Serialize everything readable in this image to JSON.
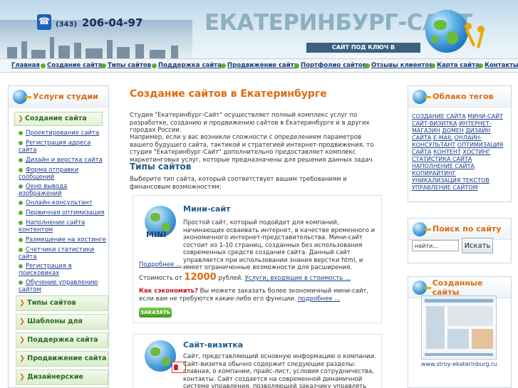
{
  "header": {
    "phone_code": "(343)",
    "phone_number": "206-04-97",
    "site_title": "ЕКАТЕРИНБУРГ-САЙТ",
    "slogan": "САЙТ ПОД КЛЮЧ В ЕКАТЕРИНБУРГЕ"
  },
  "topnav": [
    "Главная",
    "Создание сайта",
    "Типы сайтов",
    "Поддержка сайта",
    "Продвижение сайта",
    "Портфолио сайтов",
    "Отзывы клиентов",
    "Карта сайта",
    "Контакты"
  ],
  "left": {
    "title": "Услуги студии",
    "active_section": "Создание сайта",
    "sub_items": [
      "Проектирование сайта",
      "Регистрация адреса сайта",
      "Дизайн и верстка сайта",
      "Форма отправки сообщений",
      "Окно вывода изображений",
      "Онлайн-консультант",
      "Первичная оптимизация",
      "Наполнение сайта контентом",
      "Размещение на хостинге",
      "Счетчики статистики сайта",
      "Регистрация в поисковиках",
      "Обучение управлению сайтом"
    ],
    "sections": [
      "Типы сайтов",
      "Шаблоны для сайтов",
      "Поддержка сайта",
      "Продвижение сайта",
      "Дизайнерские услуги"
    ]
  },
  "main": {
    "title": "Создание сайтов в Екатеринбурге",
    "intro_1": "Студия \"Екатеринбург-Сайт\" осуществляет полный комплекс услуг по разработке, созданию и продвижению сайтов в Екатеринбурге и в других городах России.",
    "intro_2": "Например, если у вас возникли сложности с определением параметров вашего будущего сайта, тактикой и стратегией интернет-продвижения, то студия \"Екатеринбург-Сайт\" дополнительно предоставляет комплекс маркетинговых услуг, которые предназначены для решения данных задач.",
    "types_title": "Типы сайтов",
    "types_intro": "Выберите тип сайта, который соответствует вашим требованиям и финансовым возможностям:",
    "cards": [
      {
        "title": "Мини-сайт",
        "badge": "MINI",
        "text": "Простой сайт, который подойдет для компаний, начинающих осваивать интернет, в качестве временного и экономичного интернет-представительства. Мини-сайт состоит из 1-10 страниц, созданных без использования современных средств создания сайта. Данный сайт управляется при использовании знания верстки html, и имеет ограниченные возможности для расширения.",
        "more": "Подробнее ...",
        "price_label": "Стоимость от",
        "price": "12000",
        "price_unit": "рублей.",
        "services_link": "Услуги, входящие в стоимость ...",
        "save_label": "Как сэкономить?",
        "save_text": "Вы можете заказать более экономичный мини-сайт, если вам не требуются какие-либо его функции.",
        "save_more": "подробнее ...",
        "order_label": "ЗАКАЗАТЬ"
      },
      {
        "title": "Сайт-визитка",
        "text": "Сайт, представляющий основную информацию о компании. Сайт-визитка обычно содержит следующие разделы: главная, о компании, прайс-лист, условия сотрудничества, контакты. Сайт создается на современной динамичной системе управления, позволяющей заказчику управлять сайтом без специальных"
      }
    ]
  },
  "right": {
    "tags_title": "Облако тегов",
    "tags": [
      "Создание сайта",
      "Мини-сайт",
      "Сайт-визитка",
      "Интернет-магазин",
      "Домен",
      "Дизайн сайта",
      "E-mail",
      "Онлайн-консультант",
      "Оптимизация сайта",
      "Контент",
      "Хостинг",
      "Статистика сайта",
      "Наполнение сайта",
      "Копирайтинг",
      "Уникализация текстов",
      "Управление сайтом"
    ],
    "search_title": "Поиск по сайту",
    "search_value": "найти...",
    "search_button": "Искать",
    "sites_title": "Созданные сайты",
    "site_caption": "www.stroy-ekaterinburg.ru"
  },
  "colors": {
    "accent": "#e06a0e",
    "link": "#1c3f8a",
    "green": "#5ab02e"
  }
}
